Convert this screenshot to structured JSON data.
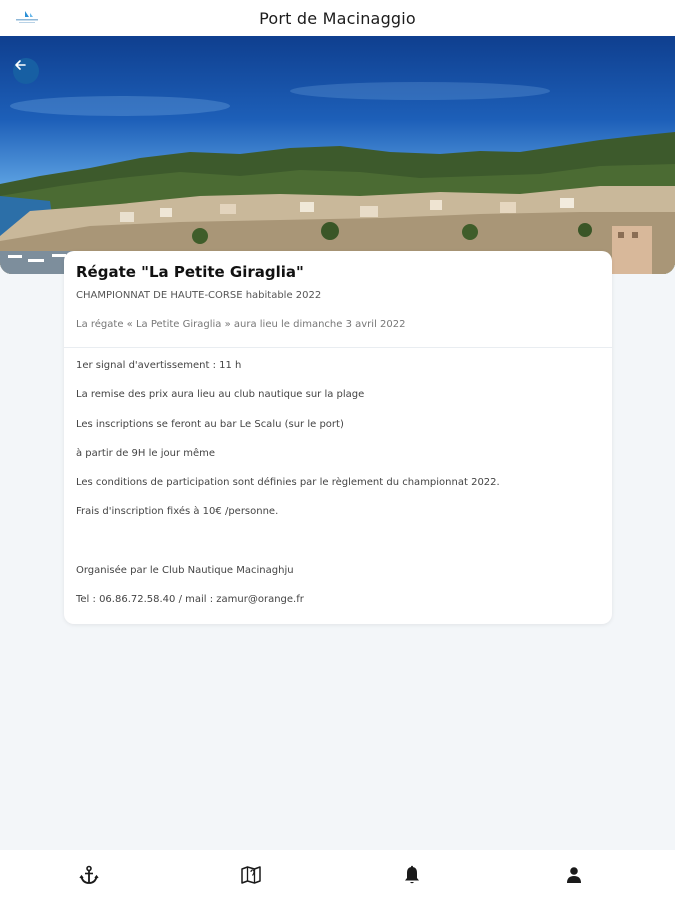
{
  "header": {
    "title": "Port de Macinaggio"
  },
  "event": {
    "title": "Régate \"La Petite Giraglia\"",
    "subtitle": "CHAMPIONNAT DE HAUTE-CORSE habitable 2022",
    "summary": "La régate « La Petite Giraglia » aura lieu le dimanche 3 avril 2022",
    "details": [
      "1er signal d'avertissement : 11 h",
      "La remise des prix aura lieu au club nautique sur la plage",
      "Les inscriptions se feront au bar Le Scalu (sur le port)",
      "à partir de 9H le jour même",
      "Les conditions de participation sont définies par le règlement du championnat 2022.",
      "Frais d'inscription fixés à 10€ /personne.",
      "",
      "Organisée par le Club Nautique Macinaghju",
      "Tel : 06.86.72.58.40 / mail : zamur@orange.fr"
    ]
  },
  "nav": {
    "items": [
      {
        "icon": "anchor-icon"
      },
      {
        "icon": "map-icon"
      },
      {
        "icon": "bell-icon"
      },
      {
        "icon": "user-icon"
      }
    ]
  },
  "colors": {
    "accent": "#175fa3",
    "background": "#f3f6f9",
    "card": "#ffffff",
    "icon": "#1a1a1a"
  }
}
